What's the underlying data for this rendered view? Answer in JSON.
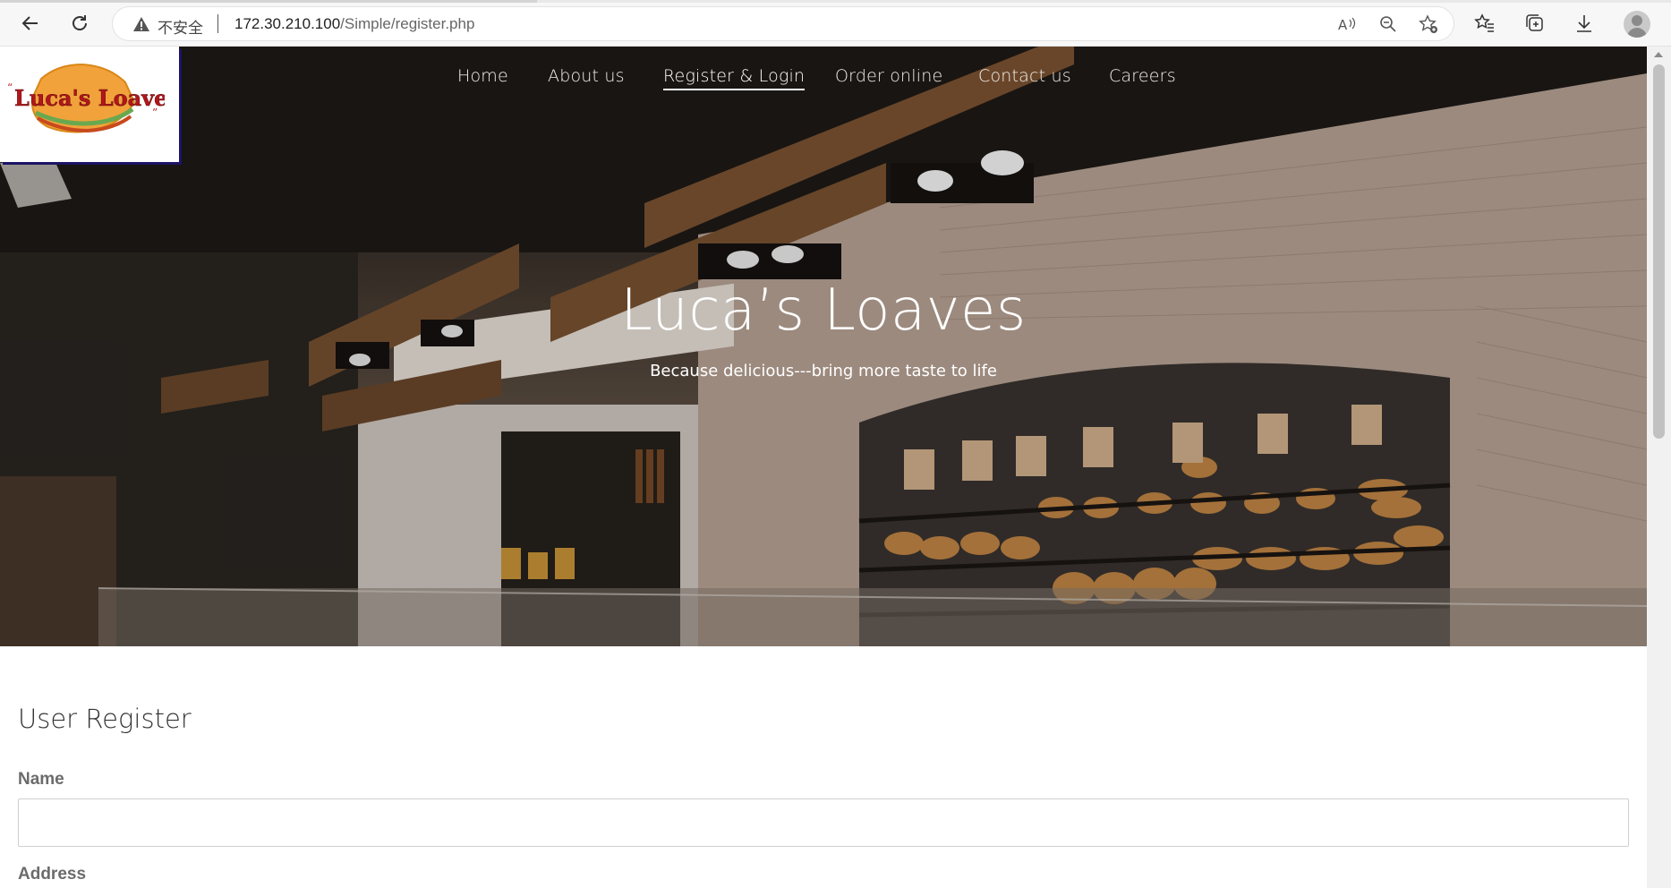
{
  "browser": {
    "security_label": "不安全",
    "url_host": "172.30.210.100",
    "url_path": "/Simple/register.php"
  },
  "site": {
    "logo_text": "Luca's Loaves",
    "nav": [
      {
        "label": "Home"
      },
      {
        "label": "About us"
      },
      {
        "label": "Register & Login",
        "active": true
      },
      {
        "label": "Order online"
      },
      {
        "label": "Contact us"
      },
      {
        "label": "Careers"
      }
    ]
  },
  "hero": {
    "title": "Luca’s Loaves",
    "subtitle": "Because delicious---bring more taste to life"
  },
  "form": {
    "title": "User Register",
    "fields": [
      {
        "label": "Name",
        "value": ""
      },
      {
        "label": "Address",
        "value": ""
      }
    ]
  },
  "colors": {
    "nav_text": "#f3efe9",
    "form_label": "#6b6b6b",
    "logo_orange": "#f2a23a",
    "logo_text": "#b3161b"
  }
}
